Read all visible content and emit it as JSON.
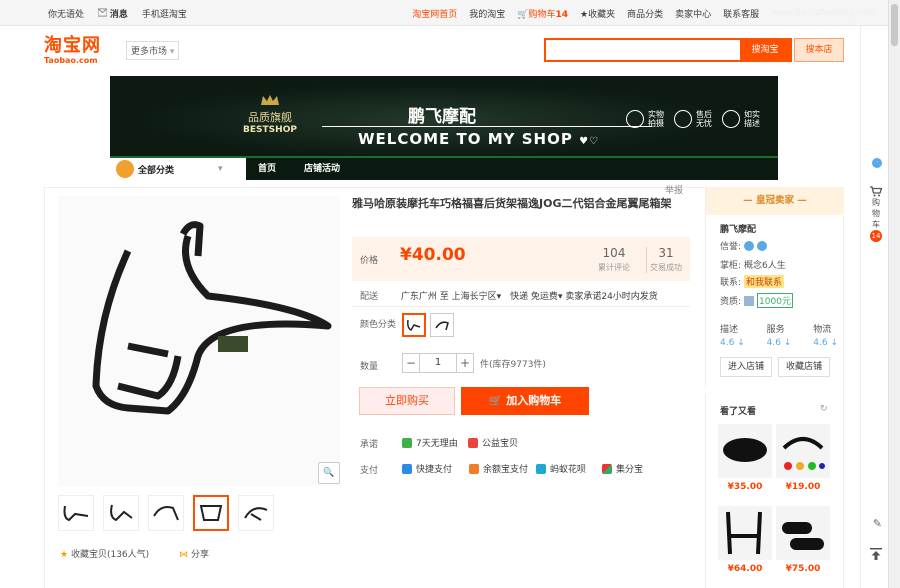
{
  "topbar": {
    "greeting": "你无语处",
    "messages": "消息",
    "mobile": "手机逛淘宝",
    "home": "淘宝网首页",
    "my_taobao": "我的淘宝",
    "cart": "购物车",
    "cart_count": "14",
    "favorites": "收藏夹",
    "categories": "商品分类",
    "seller_center": "卖家中心",
    "service": "联系客服",
    "watermark": "www.ba...zhuming.com"
  },
  "header": {
    "logo_cn": "淘宝网",
    "logo_en": "Taobao.com",
    "more_market": "更多市场",
    "search_placeholder": "",
    "search_taobao": "搜淘宝",
    "search_shop": "搜本店"
  },
  "banner": {
    "shop_name": "鹏飞摩配",
    "welcome": "WELCOME TO MY SHOP",
    "badge_cn": "品质旗舰",
    "badge_en": "BESTSHOP",
    "icons": [
      {
        "label1": "实物",
        "label2": "拍摄"
      },
      {
        "label1": "售后",
        "label2": "无忧"
      },
      {
        "label1": "如实",
        "label2": "描述"
      }
    ]
  },
  "shopnav": {
    "all_categories": "全部分类",
    "home": "首页",
    "events": "店铺活动"
  },
  "product": {
    "report": "举报",
    "title": "雅马哈原装摩托车巧格福喜后货架福逸JOG二代铝合金尾翼尾箱架",
    "price_label": "价格",
    "price": "¥40.00",
    "reviews_count": "104",
    "reviews_label": "累计评论",
    "sales_count": "31",
    "sales_label": "交易成功",
    "ship_label": "配送",
    "ship_from": "广东广州 至",
    "ship_to": "上海长宁区",
    "express": "快递 免运费",
    "ship_promise": "卖家承诺24小时内发货",
    "color_label": "颜色分类",
    "qty_label": "数量",
    "qty_value": "1",
    "stock": "件(库存9773件)",
    "buy_now": "立即购买",
    "add_to_cart": "加入购物车",
    "promise_label": "承诺",
    "promise_7days": "7天无理由",
    "promise_charity": "公益宝贝",
    "pay_label": "支付",
    "pay_quick": "快捷支付",
    "pay_balance": "余额宝支付",
    "pay_huabei": "蚂蚁花呗",
    "pay_jifen": "集分宝",
    "fav_label": "收藏宝贝",
    "fav_count": "(136人气)",
    "share": "分享"
  },
  "seller": {
    "header": "皇冠卖家",
    "name": "鹏飞摩配",
    "credit_label": "信誉:",
    "owner_label": "掌柜:",
    "owner": "概念6人生",
    "contact_label": "联系:",
    "contact": "和我联系",
    "qual_label": "资质:",
    "deposit": "1000元",
    "scores": [
      {
        "label": "描述",
        "value": "4.6"
      },
      {
        "label": "服务",
        "value": "4.6"
      },
      {
        "label": "物流",
        "value": "4.6"
      }
    ],
    "enter_shop": "进入店铺",
    "fav_shop": "收藏店铺"
  },
  "also_viewed": {
    "title": "看了又看",
    "items": [
      {
        "price": "¥35.00"
      },
      {
        "price": "¥19.00"
      },
      {
        "price": "¥64.00"
      },
      {
        "price": "¥75.00"
      }
    ]
  },
  "rail": {
    "cart_label1": "购",
    "cart_label2": "物",
    "cart_label3": "车",
    "cart_count": "14"
  },
  "colors": {
    "brand": "#ff5000",
    "price": "#ff4400"
  }
}
